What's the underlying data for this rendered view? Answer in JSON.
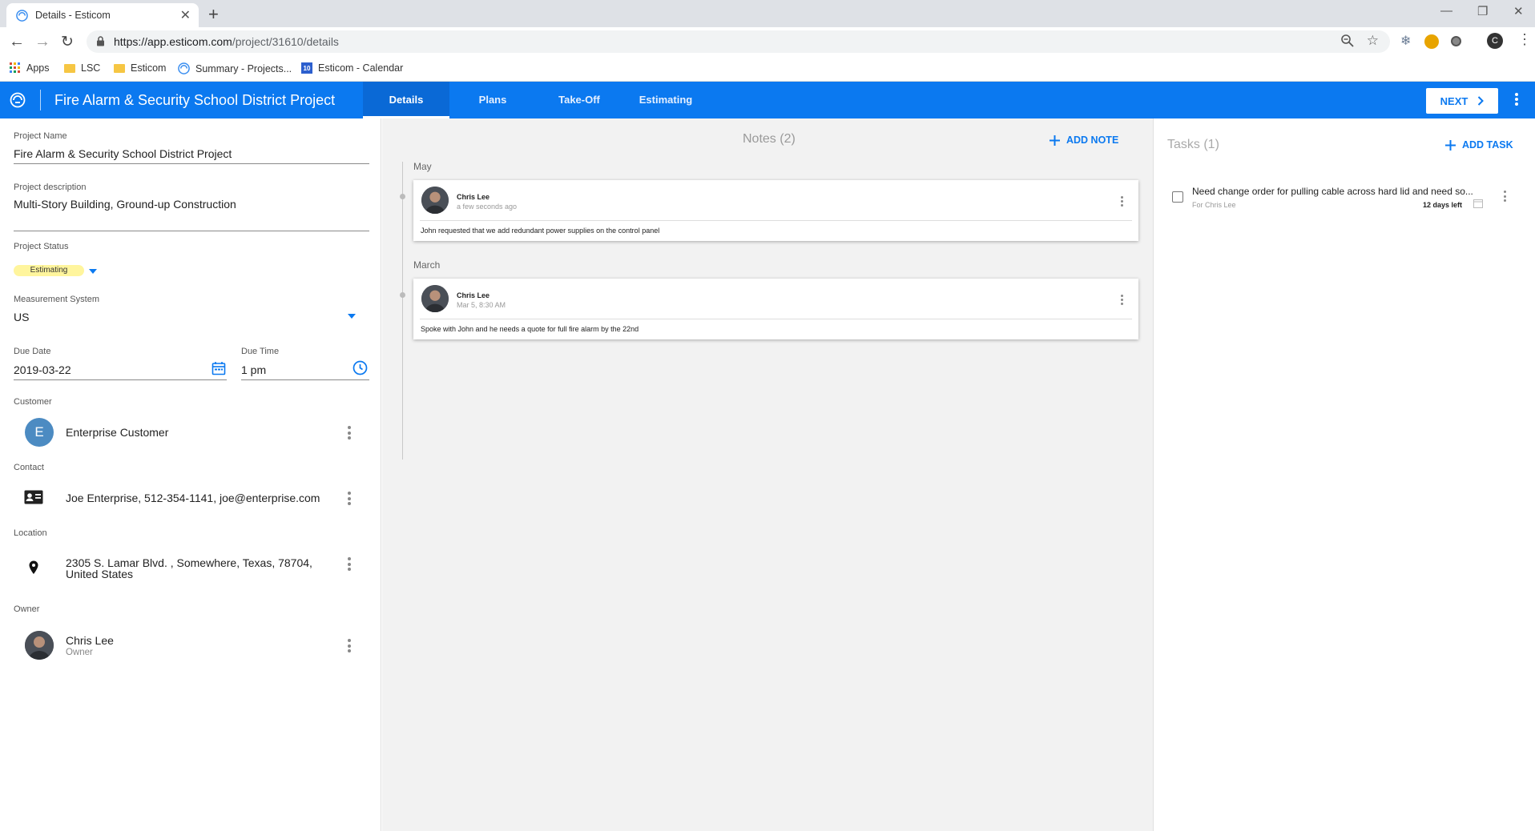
{
  "browser": {
    "tab_title": "Details - Esticom",
    "url_host": "https://app.esticom.com",
    "url_path": "/project/31610/details",
    "profile_initial": "C",
    "bookmarks": [
      {
        "label": "Apps",
        "icon": "apps-grid-icon"
      },
      {
        "label": "LSC",
        "icon": "folder-icon"
      },
      {
        "label": "Esticom",
        "icon": "folder-icon"
      },
      {
        "label": "Summary - Projects...",
        "icon": "esticom-icon"
      },
      {
        "label": "Esticom - Calendar",
        "icon": "calendar-icon"
      }
    ],
    "calendar_day": "10"
  },
  "appbar": {
    "project_title": "Fire Alarm & Security School District Project",
    "tabs": [
      "Details",
      "Plans",
      "Take-Off",
      "Estimating"
    ],
    "active_tab": "Details",
    "next_label": "NEXT",
    "brand_color": "#0b79f0"
  },
  "details": {
    "project_name_label": "Project Name",
    "project_name": "Fire Alarm & Security School District Project",
    "description_label": "Project description",
    "description": "Multi-Story Building, Ground-up Construction",
    "status_label": "Project Status",
    "status": "Estimating",
    "measurement_label": "Measurement System",
    "measurement": "US",
    "due_date_label": "Due Date",
    "due_date": "2019-03-22",
    "due_time_label": "Due Time",
    "due_time": "1 pm",
    "customer_label": "Customer",
    "customer_initial": "E",
    "customer": "Enterprise Customer",
    "contact_label": "Contact",
    "contact": "Joe Enterprise, 512-354-1141, joe@enterprise.com",
    "location_label": "Location",
    "location_line1": "2305 S. Lamar Blvd. , Somewhere, Texas, 78704,",
    "location_line2": "United States",
    "owner_label": "Owner",
    "owner_name": "Chris Lee",
    "owner_role": "Owner"
  },
  "notes": {
    "title": "Notes (2)",
    "add_label": "ADD NOTE",
    "groups": [
      {
        "month": "May",
        "author": "Chris Lee",
        "time": "a few seconds ago",
        "text": "John requested that we add redundant power supplies on the control panel"
      },
      {
        "month": "March",
        "author": "Chris Lee",
        "time": "Mar 5, 8:30 AM",
        "text": "Spoke with John and he needs a quote for full fire alarm by the 22nd"
      }
    ]
  },
  "tasks": {
    "title": "Tasks (1)",
    "add_label": "ADD TASK",
    "items": [
      {
        "text": "Need change order for pulling cable across hard lid and need so...",
        "assignee": "For Chris Lee",
        "due": "12 days left"
      }
    ]
  }
}
